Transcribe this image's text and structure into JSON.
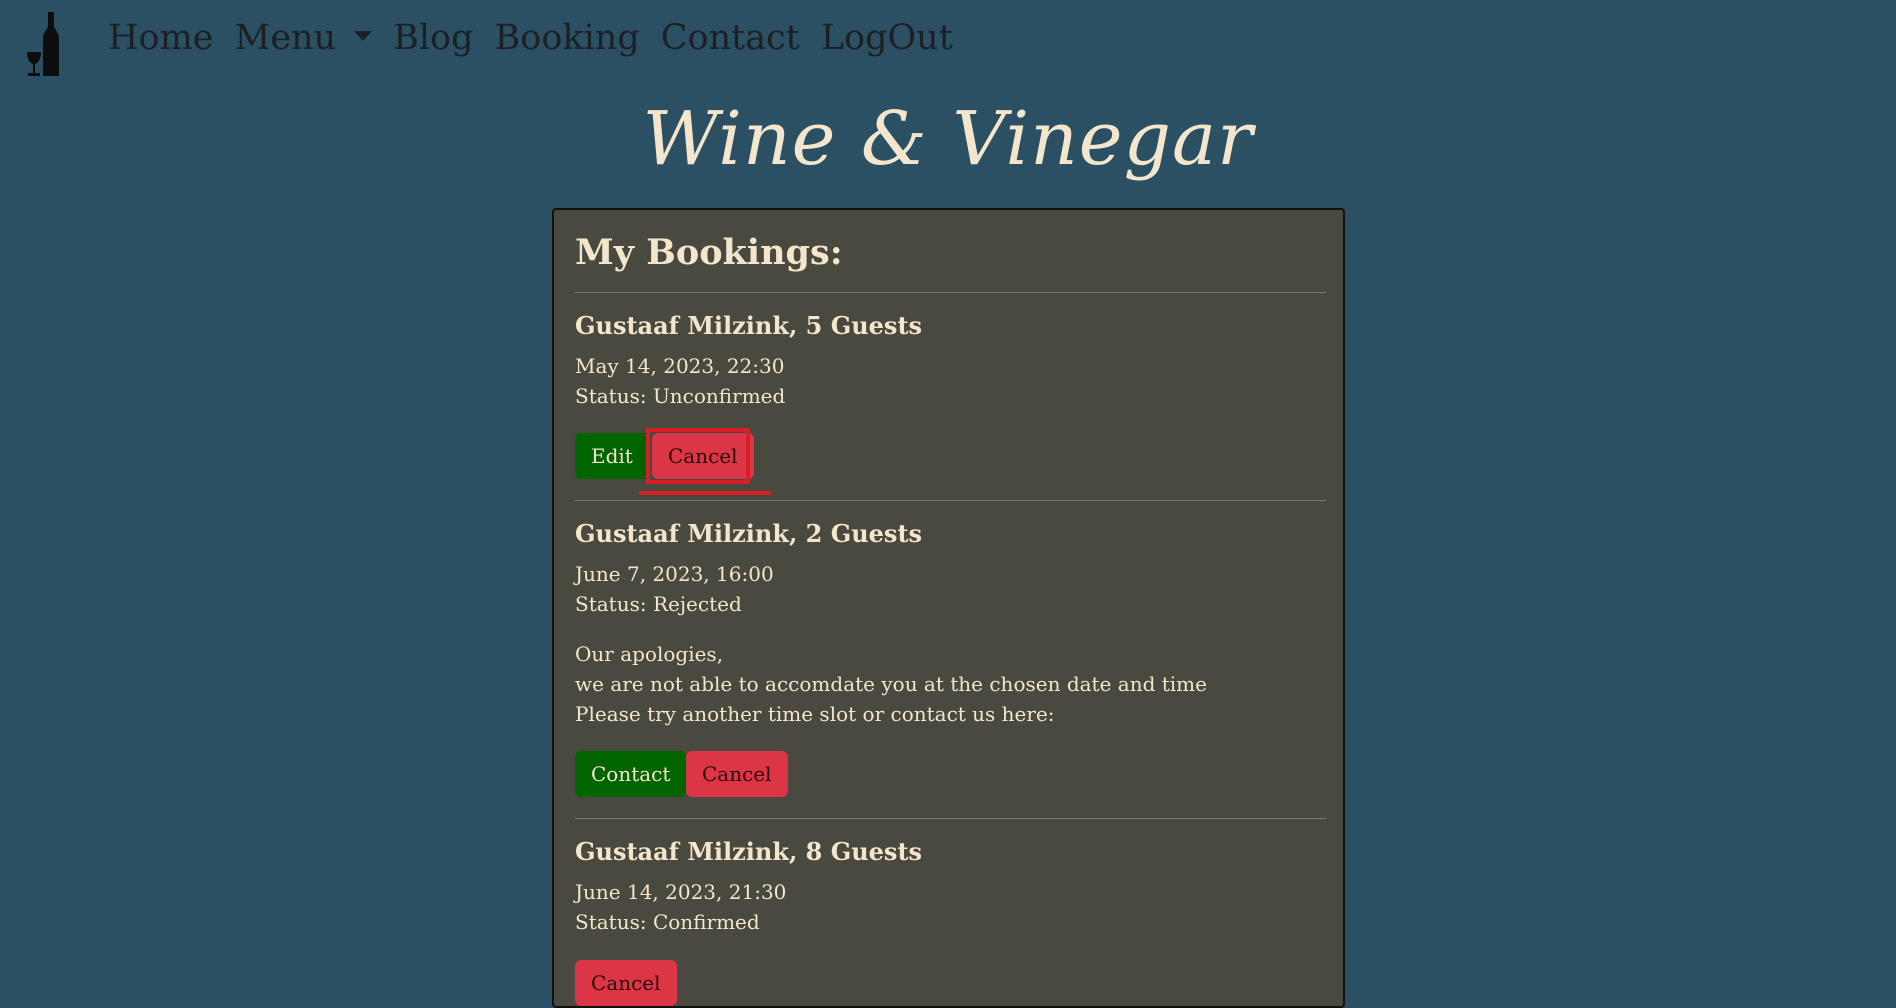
{
  "nav": {
    "logo_icon": "wine-bottle-glass-icon",
    "items": [
      {
        "label": "Home"
      },
      {
        "label": "Menu",
        "has_dropdown": true
      },
      {
        "label": "Blog"
      },
      {
        "label": "Booking"
      },
      {
        "label": "Contact"
      },
      {
        "label": "LogOut"
      }
    ]
  },
  "brand": {
    "title": "Wine & Vinegar"
  },
  "bookings": {
    "heading": "My Bookings:",
    "items": [
      {
        "name": "Gustaaf Milzink, 5 Guests",
        "datetime": "May 14, 2023, 22:30",
        "status": "Status: Unconfirmed",
        "buttons": [
          "Edit",
          "Cancel"
        ]
      },
      {
        "name": "Gustaaf Milzink, 2 Guests",
        "datetime": "June 7, 2023, 16:00",
        "status": "Status: Rejected",
        "message": [
          "Our apologies,",
          "we are not able to accomdate you at the chosen date and time",
          "Please try another time slot or contact us here:"
        ],
        "buttons": [
          "Contact",
          "Cancel"
        ]
      },
      {
        "name": "Gustaaf Milzink, 8 Guests",
        "datetime": "June 14, 2023, 21:30",
        "status": "Status: Confirmed",
        "buttons": [
          "Cancel"
        ]
      }
    ]
  },
  "colors": {
    "background": "#2b5064",
    "card": "#494940",
    "text": "#f4e6cc",
    "green": "#006400",
    "red": "#dc3545",
    "highlight": "#d81f26"
  }
}
